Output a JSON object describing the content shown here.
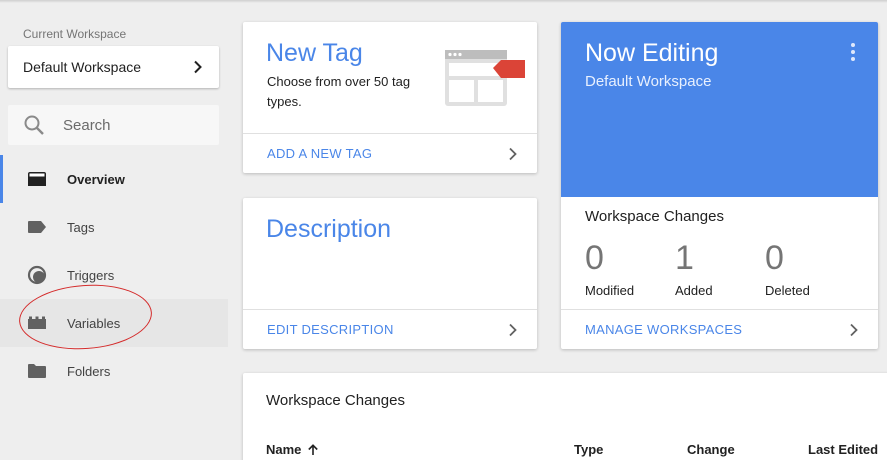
{
  "sidebar": {
    "workspace_label": "Current Workspace",
    "workspace_name": "Default Workspace",
    "search_placeholder": "Search",
    "items": [
      {
        "label": "Overview",
        "icon": "overview-icon"
      },
      {
        "label": "Tags",
        "icon": "tag-icon"
      },
      {
        "label": "Triggers",
        "icon": "trigger-icon"
      },
      {
        "label": "Variables",
        "icon": "variables-icon"
      },
      {
        "label": "Folders",
        "icon": "folder-icon"
      }
    ]
  },
  "new_tag": {
    "title": "New Tag",
    "description": "Choose from over 50 tag types.",
    "action": "ADD A NEW TAG"
  },
  "description_card": {
    "title": "Description",
    "action": "EDIT DESCRIPTION"
  },
  "now_editing": {
    "title": "Now Editing",
    "workspace": "Default Workspace",
    "changes_title": "Workspace Changes",
    "stats": [
      {
        "value": "0",
        "label": "Modified"
      },
      {
        "value": "1",
        "label": "Added"
      },
      {
        "value": "0",
        "label": "Deleted"
      }
    ],
    "action": "MANAGE WORKSPACES"
  },
  "workspace_changes": {
    "title": "Workspace Changes",
    "columns": [
      "Name",
      "Type",
      "Change",
      "Last Edited"
    ]
  },
  "colors": {
    "accent": "#4a86e8",
    "background": "#eeeeee",
    "annotation": "#d42a2a"
  }
}
